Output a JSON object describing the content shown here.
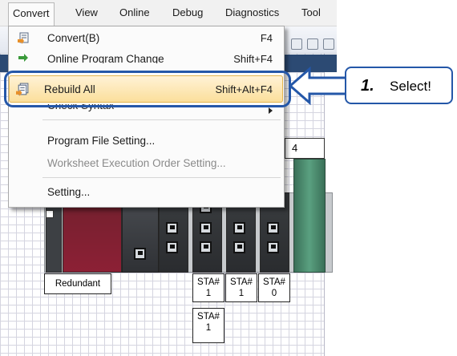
{
  "menubar": {
    "items": [
      "Convert",
      "View",
      "Online",
      "Debug",
      "Diagnostics",
      "Tool"
    ]
  },
  "convert_menu": {
    "items": [
      {
        "label": "Convert(B)",
        "shortcut": "F4",
        "icon": "convert-icon"
      },
      {
        "label": "Online Program Change",
        "shortcut": "Shift+F4",
        "icon": "online-change-icon"
      },
      {
        "label": "Rebuild All",
        "shortcut": "Shift+Alt+F4",
        "icon": "rebuild-icon",
        "highlighted": true
      },
      {
        "label": "Check Syntax",
        "shortcut": "",
        "has_submenu": true
      },
      {
        "label": "Program File Setting...",
        "shortcut": ""
      },
      {
        "label": "Worksheet Execution Order Setting...",
        "shortcut": "",
        "disabled": true
      },
      {
        "label": "Setting...",
        "shortcut": ""
      }
    ]
  },
  "callout": {
    "number": "1.",
    "text": "Select!"
  },
  "module_config": {
    "slot_number": "4",
    "labels": {
      "redundant": "Redundant",
      "sta_a": "STA#\n1",
      "sta_b": "STA#\n1",
      "sta_c": "STA#\n0",
      "sta_d": "STA#\n1"
    }
  },
  "colors": {
    "highlight_border": "#2457a8",
    "highlight_fill": "#fbdf9b",
    "red_module": "#8c2035",
    "green_module": "#5aa080"
  }
}
